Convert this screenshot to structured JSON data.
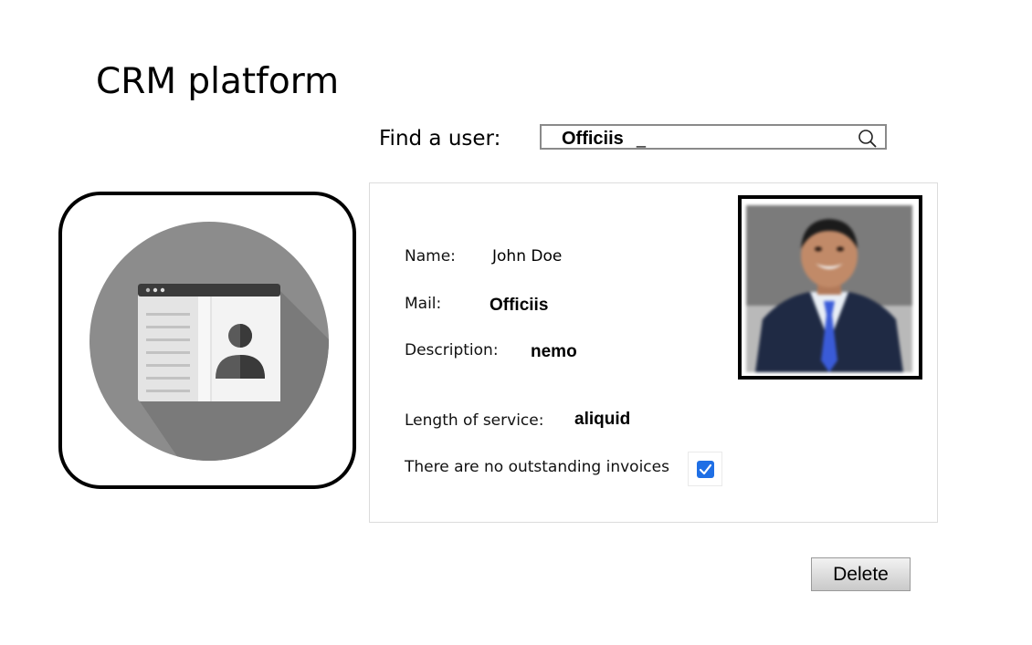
{
  "app": {
    "title": "CRM platform"
  },
  "search": {
    "label": "Find a user:",
    "value": "Officiis",
    "cursor": "_"
  },
  "logo": {
    "icon": "contact-card-icon"
  },
  "profile": {
    "name_label": "Name:",
    "name_value": "John Doe",
    "mail_label": "Mail:",
    "mail_value": "Officiis",
    "description_label": "Description:",
    "description_value": "nemo",
    "service_label": "Length of service:",
    "service_value": "aliquid",
    "invoices_label": "There are no outstanding invoices",
    "invoices_checked": true,
    "photo": "user-photo"
  },
  "actions": {
    "delete_label": "Delete"
  },
  "colors": {
    "accent": "#1f6fe5",
    "logo_circle": "#8c8c8c"
  }
}
